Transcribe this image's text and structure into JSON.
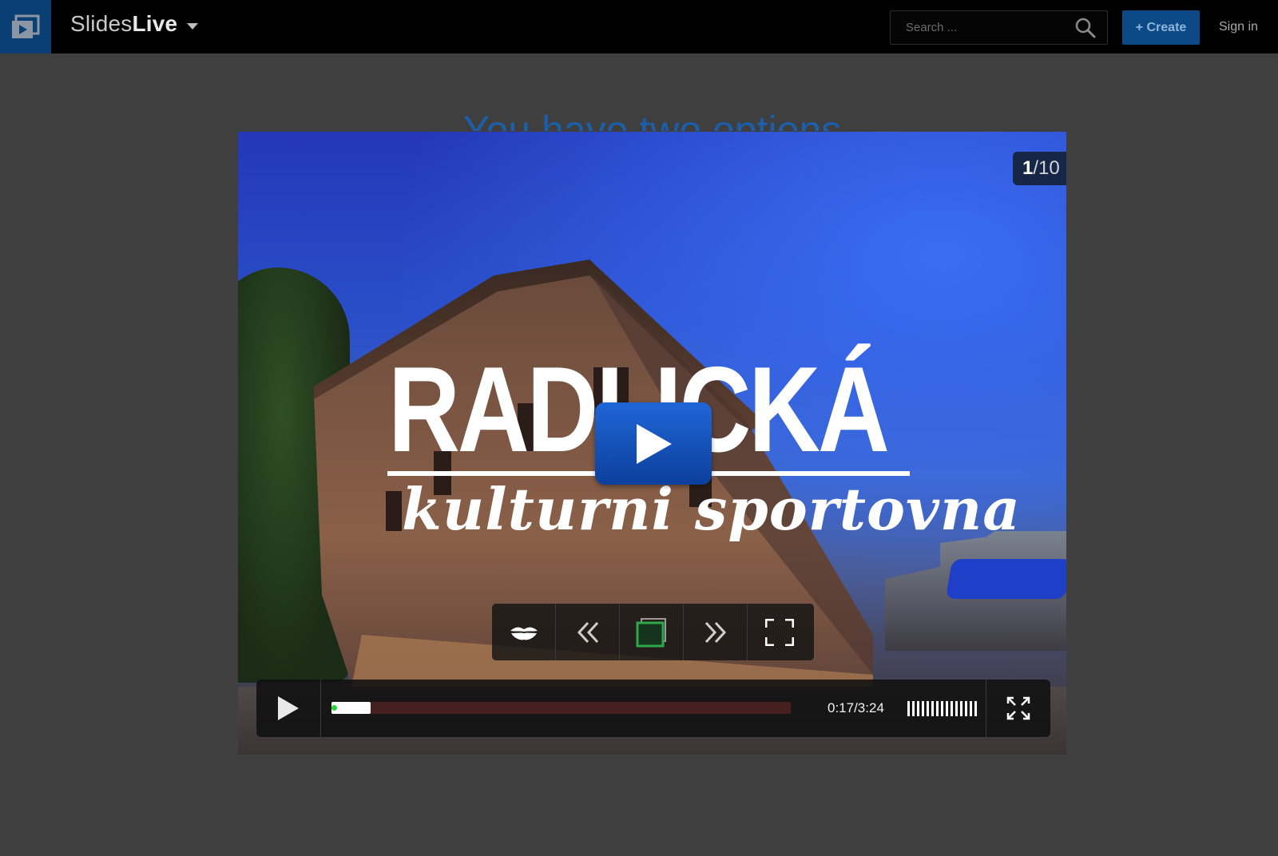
{
  "header": {
    "brand_light": "Slides",
    "brand_bold": "Live",
    "search_placeholder": "Search ...",
    "create_label": "+ Create",
    "signin_label": "Sign in"
  },
  "slide_heading": "You have two options",
  "slide": {
    "title": "RADLICKÁ",
    "subtitle": "kulturni sportovna",
    "counter_current": "1",
    "counter_total": "/10"
  },
  "player": {
    "time": "0:17/3:24",
    "progress_fraction": 0.085,
    "volume_bars": 15
  },
  "colors": {
    "accent": "#0b4a86",
    "play_button": "#1f66d6",
    "progress_dot": "#29d13b",
    "sync_icon": "#2ea84a"
  },
  "icons": {
    "logo": "slides-logo-icon",
    "search": "search-icon",
    "lips": "lips-icon",
    "prev": "double-chevron-left-icon",
    "sync": "slide-sync-icon",
    "next": "double-chevron-right-icon",
    "fullscreen": "fullscreen-corners-icon",
    "play": "play-icon",
    "expand": "expand-arrows-icon"
  }
}
